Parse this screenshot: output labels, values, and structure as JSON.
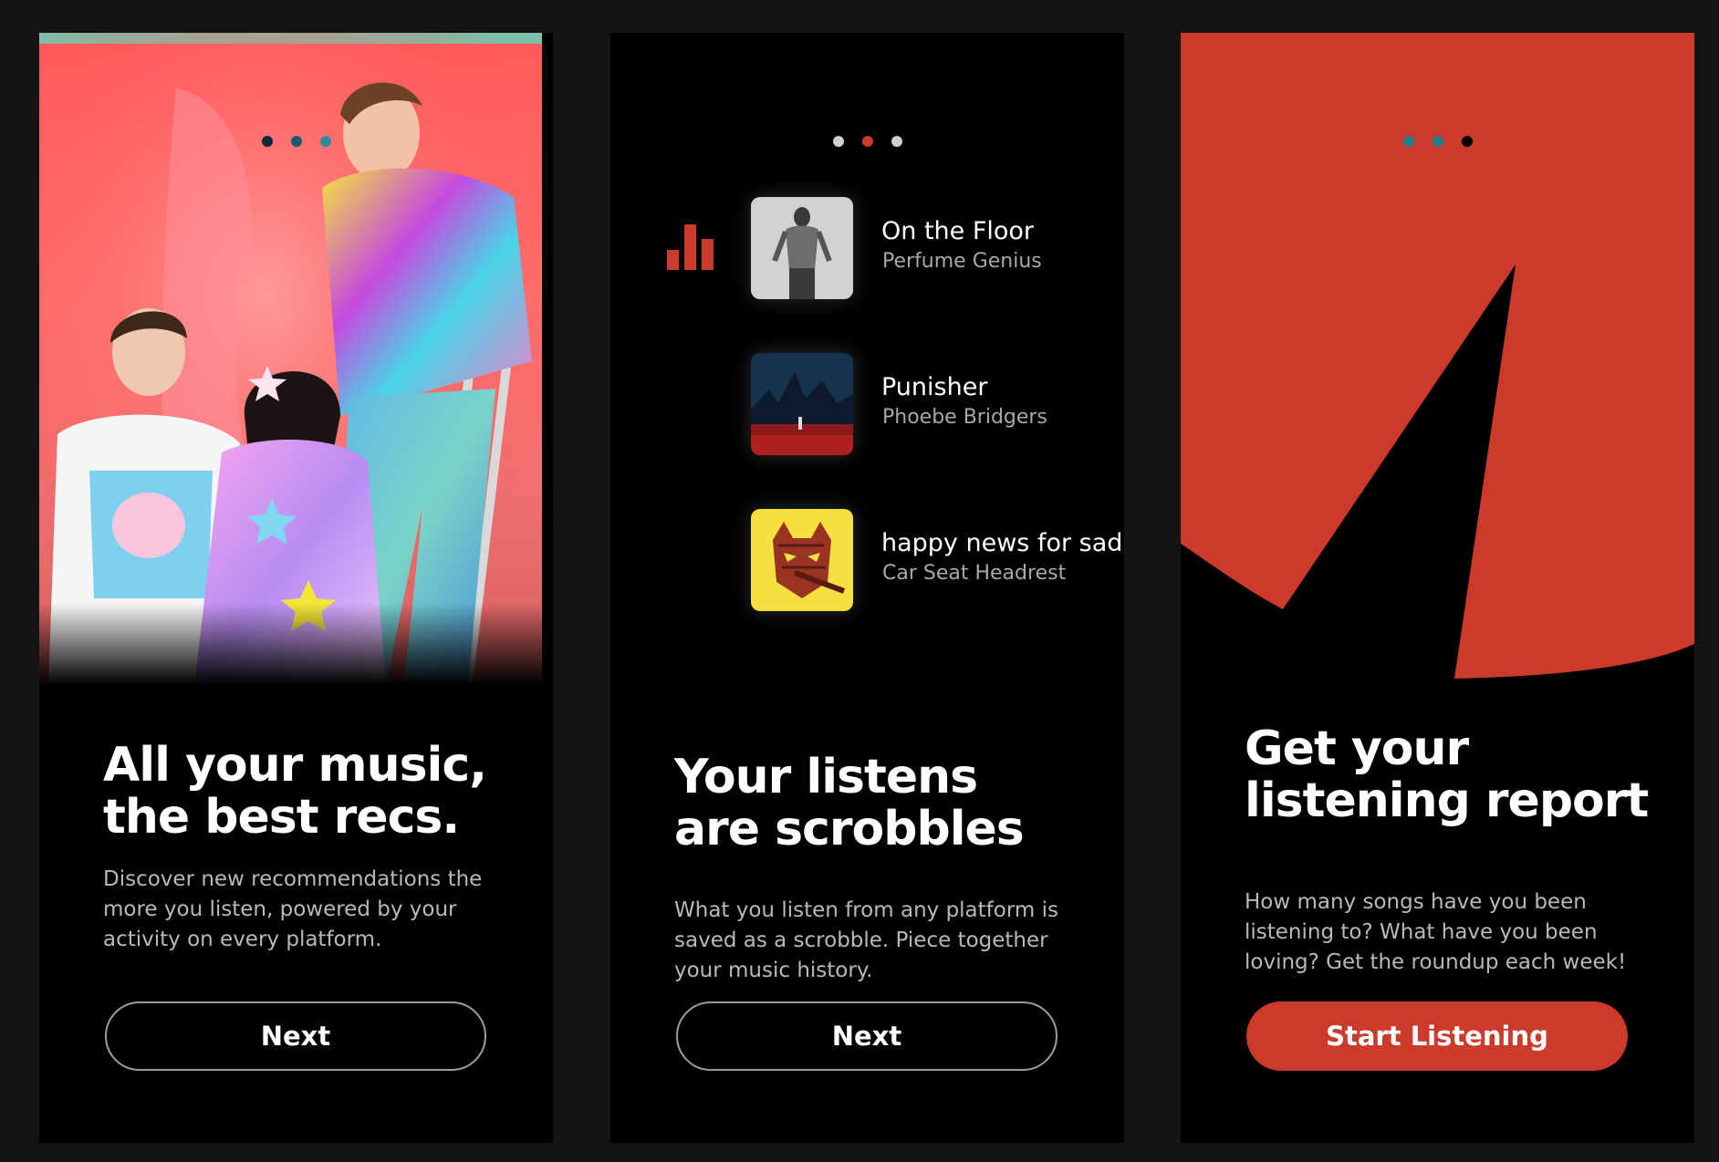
{
  "colors": {
    "accent": "#cb3a2b",
    "dot_inactive_light": "#cfcfcf",
    "dot_inactive_teal": "#1d7f8e",
    "dot_active_dark": "#000000",
    "background": "#141414"
  },
  "screens": [
    {
      "dots": [
        "#0b2a3a",
        "#1b5a6a",
        "#2b8a9a"
      ],
      "headline_line1": "All your music,",
      "headline_line2": "the best recs.",
      "body": "Discover new recommendations the more you listen, powered by your activity on every platform.",
      "button_label": "Next"
    },
    {
      "dots": [
        "#cfcfcf",
        "#cb3a2b",
        "#cfcfcf"
      ],
      "chart_icon": "bar-chart-icon",
      "tracks": [
        {
          "title": "On the Floor",
          "artist": "Perfume Genius"
        },
        {
          "title": "Punisher",
          "artist": "Phoebe Bridgers"
        },
        {
          "title": "happy news for sadness",
          "artist": "Car Seat Headrest"
        }
      ],
      "headline_line1": "Your listens",
      "headline_line2": "are scrobbles",
      "body": "What you listen from any platform is saved as a scrobble. Piece together your music history.",
      "button_label": "Next"
    },
    {
      "dots": [
        "#1d7f8e",
        "#1d7f8e",
        "#000000"
      ],
      "headline_line1": "Get your",
      "headline_line2": "listening report",
      "body": "How many songs have you been listening to? What have you been loving? Get the roundup each week!",
      "button_label": "Start Listening"
    }
  ]
}
